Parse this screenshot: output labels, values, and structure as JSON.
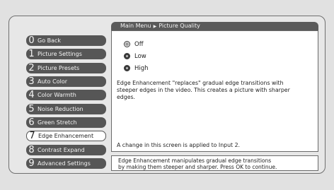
{
  "breadcrumb": {
    "parent": "Main Menu",
    "separator": "▶",
    "current": "Picture Quality"
  },
  "menu": [
    {
      "num": "0",
      "label": "Go Back"
    },
    {
      "num": "1",
      "label": "Picture Settings"
    },
    {
      "num": "2",
      "label": "Picture Presets"
    },
    {
      "num": "3",
      "label": "Auto Color"
    },
    {
      "num": "4",
      "label": "Color Warmth"
    },
    {
      "num": "5",
      "label": "Noise Reduction"
    },
    {
      "num": "6",
      "label": "Green Stretch"
    },
    {
      "num": "7",
      "label": "Edge Enhancement",
      "selected": true
    },
    {
      "num": "8",
      "label": "Contrast Expand"
    },
    {
      "num": "9",
      "label": "Advanced Settings"
    }
  ],
  "options": [
    {
      "label": "Off",
      "state": "unselected"
    },
    {
      "label": "Low",
      "state": "unselected"
    },
    {
      "label": "High",
      "state": "selected"
    }
  ],
  "description": "Edge Enhancement \"replaces\" gradual edge transitions with steeper edges in the video. This creates a picture with sharper edges.",
  "applied_note": "A change in this screen is applied to Input 2.",
  "help_line1": "Edge Enhancement manipulates gradual edge transitions",
  "help_line2": "by making them steeper and sharper. Press OK to continue.",
  "colors": {
    "menu_bg": "#565656",
    "selected_bg": "#ffffff",
    "page_bg": "#e1e1e1"
  }
}
